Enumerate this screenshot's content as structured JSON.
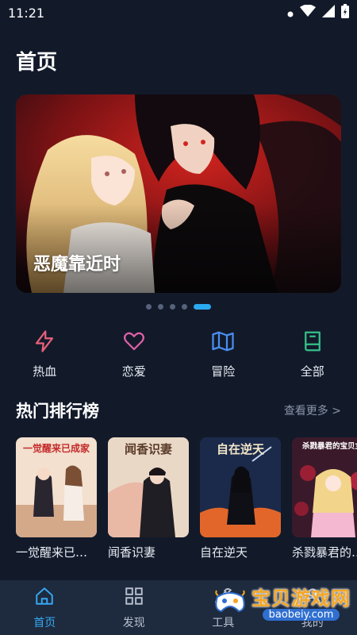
{
  "status_bar": {
    "time": "11:21"
  },
  "header": {
    "title": "首页"
  },
  "banner": {
    "title": "恶魔靠近时",
    "page_count": 5,
    "active_index": 4
  },
  "categories": [
    {
      "label": "热血",
      "icon": "lightning-icon",
      "color": "#e8607a"
    },
    {
      "label": "恋爱",
      "icon": "heart-icon",
      "color": "#e060a8"
    },
    {
      "label": "冒险",
      "icon": "map-icon",
      "color": "#4a8ef0"
    },
    {
      "label": "全部",
      "icon": "book-icon",
      "color": "#36c08a"
    }
  ],
  "hot_section": {
    "title": "热门排行榜",
    "more": "查看更多 >"
  },
  "books": [
    {
      "title": "一觉醒来已…",
      "cover_text": "一觉醒来已成家"
    },
    {
      "title": "闻香识妻",
      "cover_text": "闻香识妻"
    },
    {
      "title": "自在逆天",
      "cover_text": "自在逆天"
    },
    {
      "title": "杀戮暴君的…",
      "cover_text": "杀戮暴君的宝贝女"
    }
  ],
  "bottom_nav": [
    {
      "label": "首页",
      "icon": "home-icon",
      "active": true
    },
    {
      "label": "发现",
      "icon": "grid-icon",
      "active": false
    },
    {
      "label": "工具",
      "icon": "tools-icon",
      "active": false
    },
    {
      "label": "我的",
      "icon": "profile-icon",
      "active": false
    }
  ],
  "watermark": {
    "main": "宝贝游戏网",
    "sub": "baobeiy.com"
  },
  "colors": {
    "background": "#121a2a",
    "accent": "#2aa9f0",
    "nav_bg": "#1e2a3e"
  }
}
